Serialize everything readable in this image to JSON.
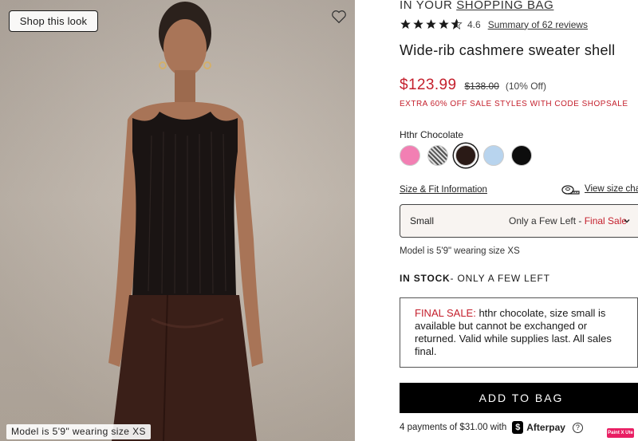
{
  "photo": {
    "shop_look_label": "Shop this look",
    "caption": "Model is 5'9\" wearing size XS"
  },
  "product": {
    "bag_prefix": "IN YOUR ",
    "bag_link": "SHOPPING BAG",
    "rating": "4.6",
    "reviews_link": "Summary of 62 reviews",
    "title": "Wide-rib cashmere sweater shell",
    "price_sale": "$123.99",
    "price_original": "$138.00",
    "price_off": "(10% Off)",
    "promo": "EXTRA 60% OFF SALE STYLES WITH CODE SHOPSALE",
    "color_label": "Hthr Chocolate",
    "swatches": [
      {
        "name": "pink",
        "color": "#f27fb3"
      },
      {
        "name": "stripe",
        "color": "#8a8680"
      },
      {
        "name": "hthr-chocolate",
        "color": "#2a1a16",
        "selected": true
      },
      {
        "name": "light-blue",
        "color": "#b8d4ee"
      },
      {
        "name": "black",
        "color": "#0d0d0d"
      }
    ],
    "size_fit_link": "Size & Fit Information",
    "view_chart_link": "View size char",
    "size_selected": "Small",
    "size_availability": "Only a Few Left - ",
    "size_final_sale": "Final Sale",
    "model_note": "Model is 5'9\" wearing size XS",
    "stock_bold": "IN STOCK",
    "stock_rest": "- ONLY A FEW LEFT",
    "final_sale_label": "FINAL SALE:",
    "final_sale_text": " hthr chocolate, size small is available but cannot be exchanged or returned. Valid while supplies last. All sales final.",
    "add_to_bag": "ADD TO BAG",
    "afterpay_text": "4 payments of $31.00 with",
    "afterpay_brand": "Afterpay",
    "help_glyph": "?"
  },
  "badge": {
    "label": "Paint X Ute"
  },
  "colors": {
    "sale_red": "#c41f2c",
    "button_black": "#000000"
  }
}
